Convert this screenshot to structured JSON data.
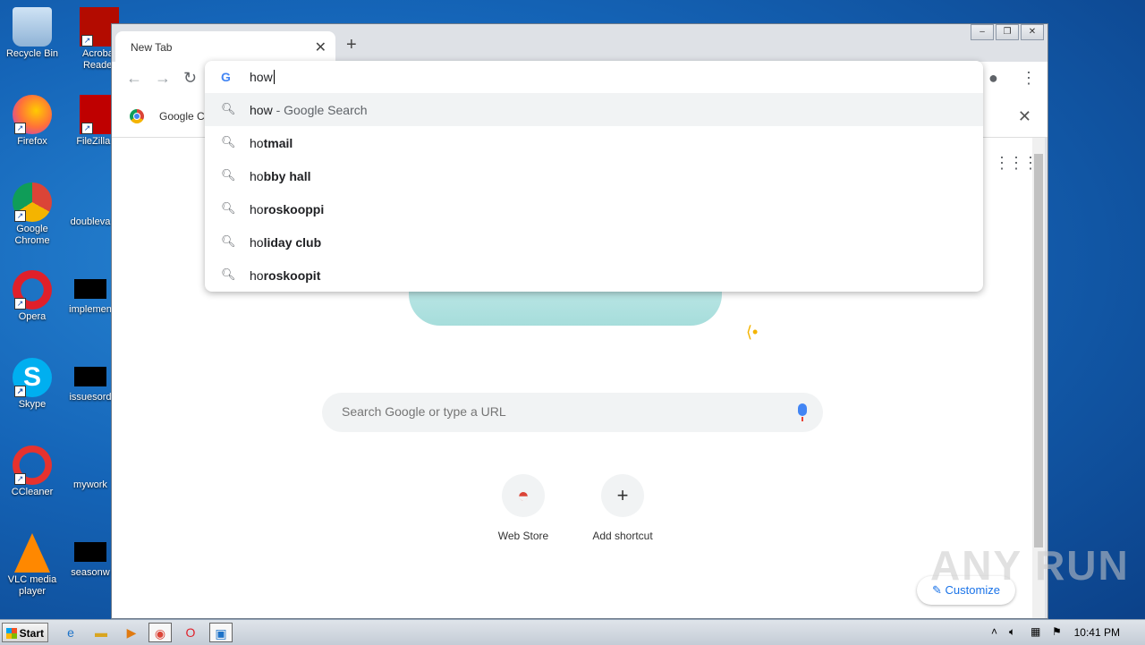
{
  "desktop": {
    "icons": [
      {
        "label": "Recycle Bin"
      },
      {
        "label": "Acrobat Reader"
      },
      {
        "label": "Firefox"
      },
      {
        "label": "FileZilla Cl"
      },
      {
        "label": "Google Chrome"
      },
      {
        "label": "doubleva"
      },
      {
        "label": "Opera"
      },
      {
        "label": "implemen"
      },
      {
        "label": "Skype"
      },
      {
        "label": "issuesord"
      },
      {
        "label": "CCleaner"
      },
      {
        "label": "mywork"
      },
      {
        "label": "VLC media player"
      },
      {
        "label": "seasonw"
      }
    ]
  },
  "browser": {
    "tab_title": "New Tab",
    "bookmark_bar": {
      "item_label": "Google Cl"
    },
    "omnibox": {
      "query": "how",
      "suggestions": [
        {
          "typed": "how",
          "completion": "",
          "suffix": " - Google Search"
        },
        {
          "typed": "ho",
          "completion": "tmail",
          "suffix": ""
        },
        {
          "typed": "ho",
          "completion": "bby hall",
          "suffix": ""
        },
        {
          "typed": "ho",
          "completion": "roskooppi",
          "suffix": ""
        },
        {
          "typed": "ho",
          "completion": "liday club",
          "suffix": ""
        },
        {
          "typed": "ho",
          "completion": "roskoopit",
          "suffix": ""
        }
      ]
    },
    "ntp": {
      "search_placeholder": "Search Google or type a URL",
      "shortcuts": [
        {
          "label": "Web Store"
        },
        {
          "label": "Add shortcut"
        }
      ],
      "customize_label": "Customize"
    }
  },
  "taskbar": {
    "start_label": "Start",
    "clock": "10:41 PM"
  },
  "watermark": "ANY RUN"
}
